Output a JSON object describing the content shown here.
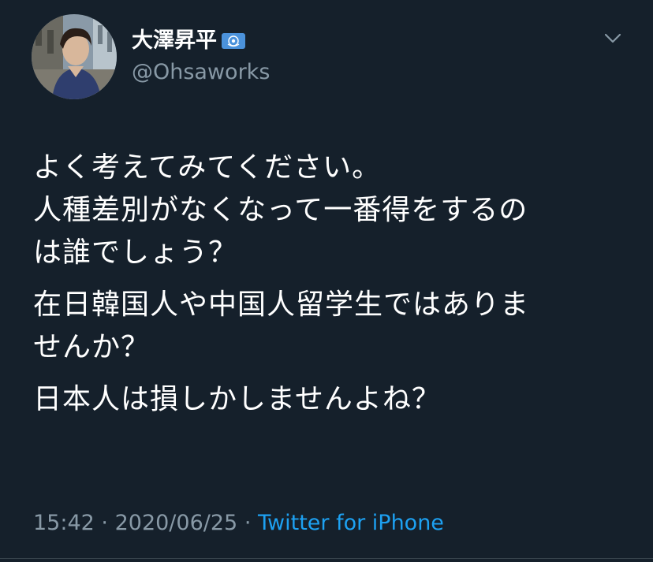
{
  "author": {
    "display_name": "大澤昇平",
    "handle": "@Ohsaworks",
    "avatar_icon": "profile-photo",
    "badge_icon": "un-flag-icon"
  },
  "menu_icon": "chevron-down-icon",
  "tweet": {
    "paragraphs": [
      {
        "lines": [
          "よく考えてみてください。",
          "人種差別がなくなって一番得をするの",
          "は誰でしょう？"
        ]
      },
      {
        "lines": [
          "在日韓国人や中国人留学生ではありま",
          "せんか？"
        ]
      },
      {
        "lines": [
          "日本人は損しかしませんよね？"
        ]
      }
    ]
  },
  "meta": {
    "time": "15:42",
    "separator": "·",
    "date": "2020/06/25",
    "source": "Twitter for iPhone"
  },
  "colors": {
    "background": "#15202b",
    "text": "#ffffff",
    "secondary": "#8899a6",
    "link": "#1da1f2"
  }
}
